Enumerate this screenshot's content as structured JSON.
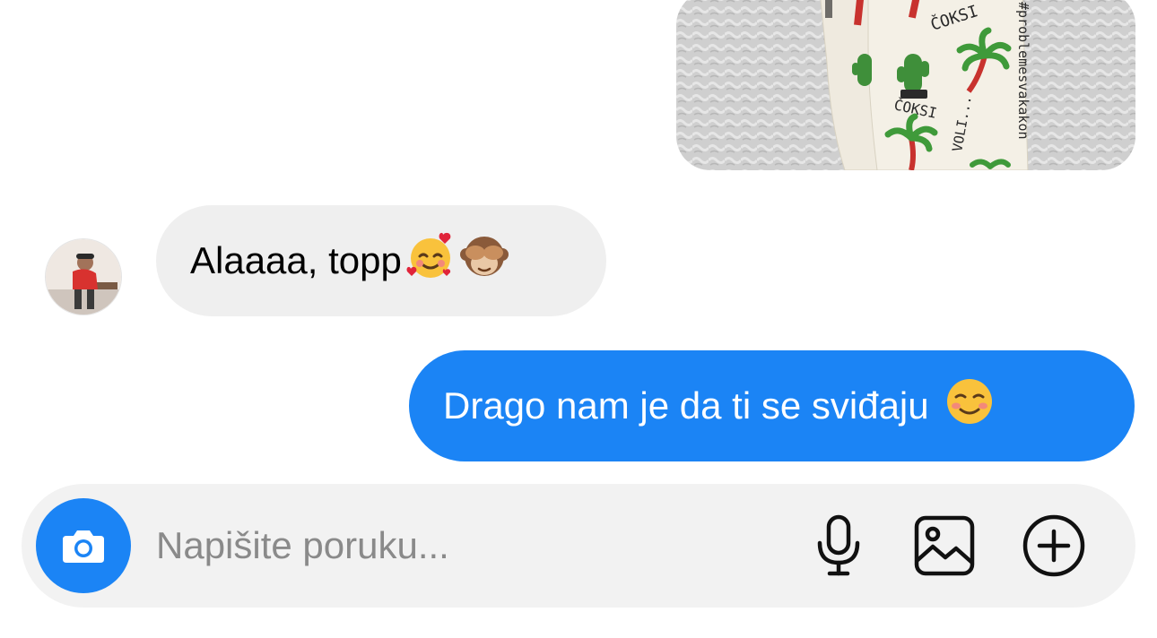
{
  "thread": {
    "attachment": {
      "photo_text": {
        "brand_top": "ČOKSI",
        "brand_bottom": "ČOKSI",
        "hashtag": "#problemesvakakon",
        "sock_text": "VOLI..."
      }
    },
    "incoming_message": {
      "text": "Alaaaa, topp",
      "emojis": [
        "smiling-face-with-hearts-icon",
        "see-no-evil-monkey-icon"
      ]
    },
    "outgoing_message": {
      "text": "Drago nam je da ti se sviđaju",
      "emojis": [
        "smiling-face-icon"
      ]
    }
  },
  "composer": {
    "placeholder": "Napišite poruku...",
    "buttons": {
      "camera": "camera-icon",
      "voice": "microphone-icon",
      "gallery": "gallery-icon",
      "more": "plus-circle-icon"
    }
  },
  "colors": {
    "accent": "#1b84f5",
    "incoming_bubble": "#efefef",
    "composer_bg": "#f2f2f2",
    "background": "#ffffff"
  }
}
